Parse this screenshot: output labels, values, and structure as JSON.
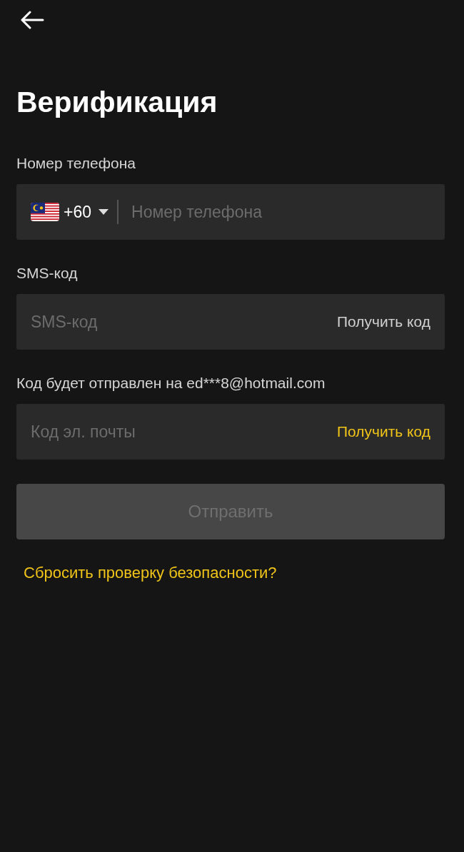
{
  "title": "Верификация",
  "fields": [
    {
      "kind": "phone",
      "label": "Номер телефона",
      "country_code": "+60",
      "placeholder": "Номер телефона"
    },
    {
      "kind": "code",
      "label": "SMS-код",
      "placeholder": "SMS-код",
      "action": {
        "label": "Получить код",
        "enabled": false
      }
    },
    {
      "kind": "code",
      "label": "Код будет отправлен на ed***8@hotmail.com",
      "placeholder": "Код эл. почты",
      "action": {
        "label": "Получить код",
        "enabled": true
      }
    }
  ],
  "submit": {
    "label": "Отправить",
    "disabled": true
  },
  "reset_link": "Сбросить проверку безопасности?"
}
